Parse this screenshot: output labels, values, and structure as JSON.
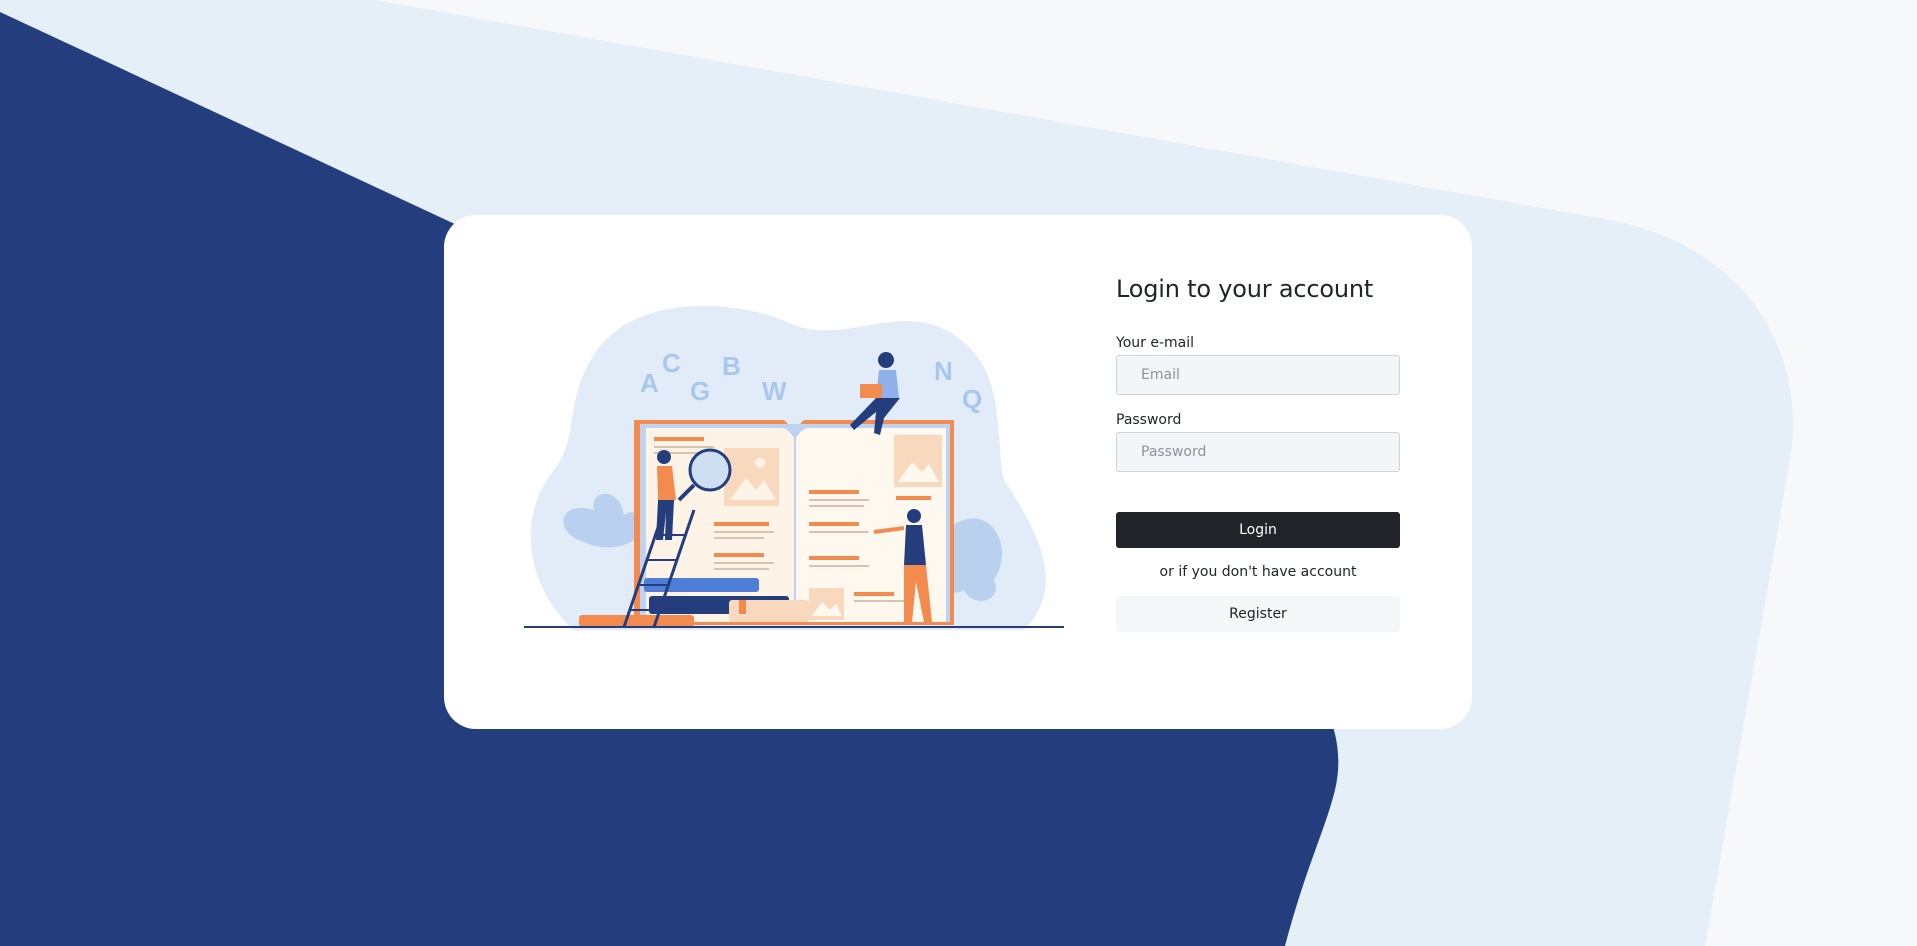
{
  "form": {
    "title": "Login to your account",
    "email_label": "Your e-mail",
    "email_placeholder": "Email",
    "email_value": "",
    "password_label": "Password",
    "password_placeholder": "Password",
    "password_value": "",
    "login_label": "Login",
    "alt_text": "or if you don't have account",
    "register_label": "Register"
  },
  "illustration": {
    "letters": [
      "A",
      "C",
      "G",
      "B",
      "W",
      "N",
      "Q"
    ]
  },
  "colors": {
    "navy": "#243e7d",
    "light_blue": "#e5eff8",
    "page_bg": "#f6f8fa",
    "button_dark": "#212529",
    "accent_orange": "#f48b4e"
  }
}
